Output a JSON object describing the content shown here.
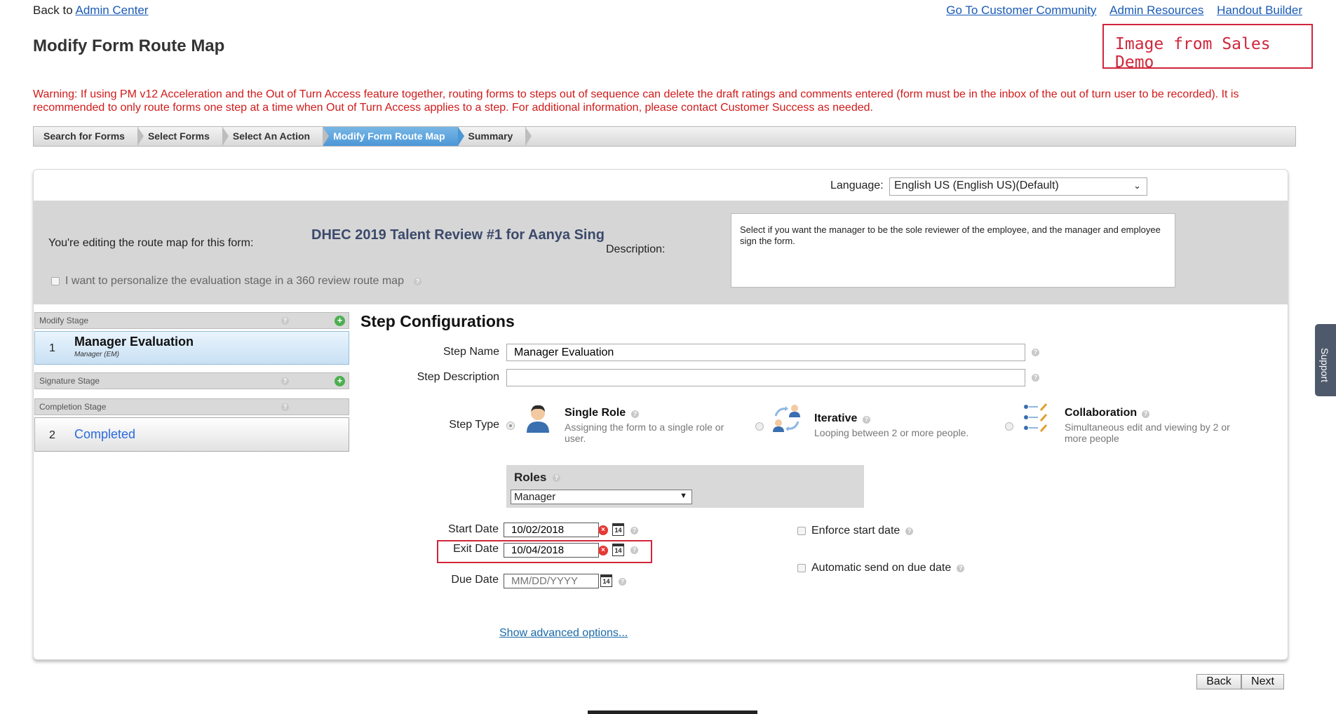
{
  "top": {
    "back_prefix": "Back to",
    "back_link": "Admin Center",
    "links": [
      "Go To Customer Community",
      "Admin Resources",
      "Handout Builder"
    ]
  },
  "page_title": "Modify Form Route Map",
  "demo_label": "Image from Sales Demo",
  "warning": "Warning: If using PM v12 Acceleration and the Out of Turn Access feature together, routing forms to steps out of sequence can delete the draft ratings and comments entered (form must be in the inbox of the out of turn user to be recorded). It is recommended to only route forms one step at a time when Out of Turn Access applies to a step. For additional information, please contact Customer Success as needed.",
  "wizard": [
    "Search for Forms",
    "Select Forms",
    "Select An Action",
    "Modify Form Route Map",
    "Summary"
  ],
  "wizard_active_index": 3,
  "language": {
    "label": "Language:",
    "value": "English US (English US)(Default)"
  },
  "form": {
    "edit_label": "You're editing the route map for this form:",
    "name": "DHEC 2019 Talent Review #1 for Aanya Sing",
    "description_label": "Description:",
    "description": "Select if you want the manager to be the sole reviewer of the employee, and the manager and employee sign the form.",
    "personalize_label": "I want to personalize the evaluation stage in a 360 review route map"
  },
  "stages": {
    "modify_head": "Modify Stage",
    "signature_head": "Signature Stage",
    "completion_head": "Completion Stage",
    "step1": {
      "num": "1",
      "title": "Manager Evaluation",
      "subtitle": "Manager (EM)"
    },
    "step2": {
      "num": "2",
      "title": "Completed"
    }
  },
  "config": {
    "title": "Step Configurations",
    "step_name_label": "Step Name",
    "step_name_value": "Manager Evaluation",
    "step_desc_label": "Step Description",
    "step_desc_value": "",
    "step_type_label": "Step Type",
    "types": [
      {
        "title": "Single Role",
        "desc": "Assigning the form to a single role or user.",
        "selected": true
      },
      {
        "title": "Iterative",
        "desc": "Looping between 2 or more people.",
        "selected": false
      },
      {
        "title": "Collaboration",
        "desc": "Simultaneous edit and viewing by 2 or more people",
        "selected": false
      }
    ],
    "roles_title": "Roles",
    "roles_value": "Manager",
    "start_date_label": "Start Date",
    "start_date": "10/02/2018",
    "exit_date_label": "Exit Date",
    "exit_date": "10/04/2018",
    "due_date_label": "Due Date",
    "due_date_placeholder": "MM/DD/YYYY",
    "calendar_day": "14",
    "enforce_label": "Enforce start date",
    "auto_send_label": "Automatic send on due date",
    "advanced_link": "Show advanced options..."
  },
  "buttons": {
    "back": "Back",
    "next": "Next"
  },
  "support": "Support"
}
